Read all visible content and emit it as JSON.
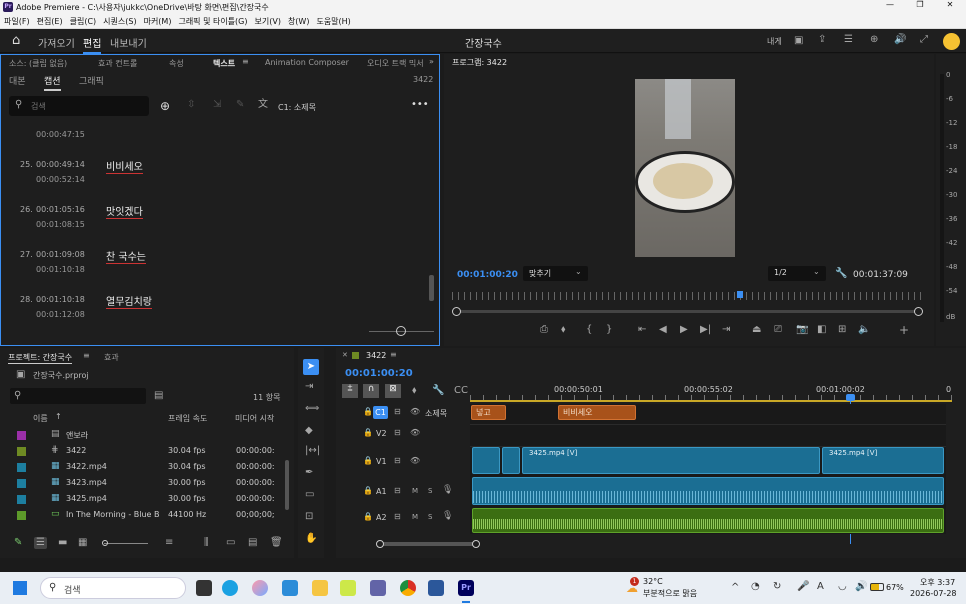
{
  "window": {
    "title": "Adobe Premiere - C:\\사용자\\jukkc\\OneDrive\\바탕 화면\\편집\\간장국수"
  },
  "menu": [
    "파일(F)",
    "편집(E)",
    "클립(C)",
    "시퀀스(S)",
    "마커(M)",
    "그래픽 및 타이틀(G)",
    "보기(V)",
    "창(W)",
    "도움말(H)"
  ],
  "appbar": {
    "tabs": [
      "가져오기",
      "편집",
      "내보내기"
    ],
    "project_title": "간장국수",
    "export_label": "내게"
  },
  "text_panel": {
    "tabs": [
      "소스: (클립 없음)",
      "효과 컨트롤",
      "속성",
      "텍스트",
      "Animation Composer",
      "오디오 트랙 믹서"
    ],
    "subtabs": [
      "대본",
      "캡션",
      "그래픽"
    ],
    "seq_number": "3422",
    "search_placeholder": "검색",
    "track_label": "C1: 소제목",
    "first_end": "00:00:47:15",
    "captions": [
      {
        "num": "25.",
        "start": "00:00:49:14",
        "end": "00:00:52:14",
        "text": "비비세오"
      },
      {
        "num": "26.",
        "start": "00:01:05:16",
        "end": "00:01:08:15",
        "text": "맛잇겠다"
      },
      {
        "num": "27.",
        "start": "00:01:09:08",
        "end": "00:01:10:18",
        "text": "찬 국수는"
      },
      {
        "num": "28.",
        "start": "00:01:10:18",
        "end": "00:01:12:08",
        "text": "열무김치랑"
      }
    ]
  },
  "program": {
    "label": "프로그램: 3422",
    "timecode": "00:01:00:20",
    "fit": "맞추기",
    "resolution": "1/2",
    "duration": "00:01:37:09",
    "meter_ticks": [
      "0",
      "-6",
      "-12",
      "-18",
      "-24",
      "-30",
      "-36",
      "-42",
      "-48",
      "-54",
      "dB"
    ]
  },
  "project": {
    "tabs": [
      "프로젝트: 간장국수",
      "효과"
    ],
    "file": "간장국수.prproj",
    "count": "11 항목",
    "headers": [
      "이름",
      "프레임 속도",
      "미디어 시작"
    ],
    "items": [
      {
        "name": "앤보라",
        "fps": "",
        "start": "",
        "color": "#9b2fa8"
      },
      {
        "name": "3422",
        "fps": "30.04 fps",
        "start": "00:00:00:",
        "color": "#6e8a23"
      },
      {
        "name": "3422.mp4",
        "fps": "30.04 fps",
        "start": "00:00:00:",
        "color": "#1d7fa0"
      },
      {
        "name": "3423.mp4",
        "fps": "30.00 fps",
        "start": "00:00:00:",
        "color": "#1d7fa0"
      },
      {
        "name": "3425.mp4",
        "fps": "30.00 fps",
        "start": "00:00:00:",
        "color": "#1d7fa0"
      },
      {
        "name": "In The Morning - Blue B",
        "fps": "44100 Hz",
        "start": "00;00;00;",
        "color": "#5d9a2a"
      }
    ]
  },
  "timeline": {
    "seq": "3422",
    "timecode": "00:01:00:20",
    "ruler": [
      "00:00:50:01",
      "00:00:55:02",
      "00:01:00:02",
      "0"
    ],
    "tracks": [
      "C1",
      "V2",
      "V1",
      "A1",
      "A2"
    ],
    "caption_track_name": "소제목",
    "captions": [
      "넣고",
      "비비세오"
    ],
    "clip_v1a": "3425.mp4 [V]",
    "clip_v1b": "3425.mp4 [V]"
  },
  "taskbar": {
    "search": "검색",
    "weather_temp": "32°C",
    "weather_desc": "부분적으로 맑음",
    "battery": "67%",
    "time": "오후 3:37",
    "date": "2026-07-28",
    "badge": "1"
  }
}
